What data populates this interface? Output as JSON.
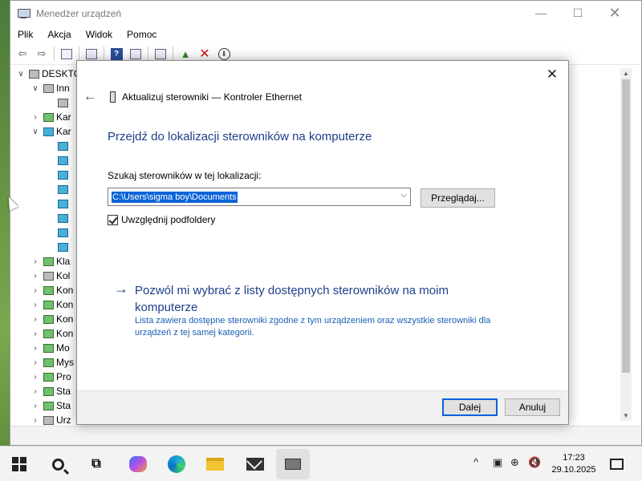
{
  "window": {
    "title": "Menedżer urządzeń",
    "min_glyph": "—",
    "max_glyph": "☐",
    "close_glyph": "✕"
  },
  "menu": [
    "Plik",
    "Akcja",
    "Widok",
    "Pomoc"
  ],
  "tree": [
    {
      "label": "DESKTO",
      "chevron": "∨",
      "indent": 0,
      "icon": "computer-icon"
    },
    {
      "label": "Inn",
      "chevron": "∨",
      "indent": 1,
      "icon": "device-icon"
    },
    {
      "label": "",
      "chevron": "",
      "indent": 2,
      "icon": "warning-device-icon"
    },
    {
      "label": "Kar",
      "chevron": "›",
      "indent": 1,
      "icon": "adapter-icon"
    },
    {
      "label": "Kar",
      "chevron": "∨",
      "indent": 1,
      "icon": "network-icon"
    },
    {
      "label": "",
      "chevron": "",
      "indent": 2,
      "icon": "network-adapter-icon"
    },
    {
      "label": "",
      "chevron": "",
      "indent": 2,
      "icon": "network-adapter-icon"
    },
    {
      "label": "",
      "chevron": "",
      "indent": 2,
      "icon": "network-adapter-icon"
    },
    {
      "label": "",
      "chevron": "",
      "indent": 2,
      "icon": "network-adapter-icon"
    },
    {
      "label": "",
      "chevron": "",
      "indent": 2,
      "icon": "network-adapter-icon"
    },
    {
      "label": "",
      "chevron": "",
      "indent": 2,
      "icon": "network-adapter-icon"
    },
    {
      "label": "",
      "chevron": "",
      "indent": 2,
      "icon": "network-adapter-icon"
    },
    {
      "label": "",
      "chevron": "",
      "indent": 2,
      "icon": "network-adapter-icon"
    },
    {
      "label": "Kla",
      "chevron": "›",
      "indent": 1,
      "icon": "keyboard-icon"
    },
    {
      "label": "Kol",
      "chevron": "›",
      "indent": 1,
      "icon": "device-icon"
    },
    {
      "label": "Kon",
      "chevron": "›",
      "indent": 1,
      "icon": "monitor-icon"
    },
    {
      "label": "Kon",
      "chevron": "›",
      "indent": 1,
      "icon": "controller-icon"
    },
    {
      "label": "Kon",
      "chevron": "›",
      "indent": 1,
      "icon": "controller-icon"
    },
    {
      "label": "Kon",
      "chevron": "›",
      "indent": 1,
      "icon": "controller-icon"
    },
    {
      "label": "Mo",
      "chevron": "›",
      "indent": 1,
      "icon": "monitor-icon"
    },
    {
      "label": "Mys",
      "chevron": "›",
      "indent": 1,
      "icon": "mouse-icon"
    },
    {
      "label": "Pro",
      "chevron": "›",
      "indent": 1,
      "icon": "processor-icon"
    },
    {
      "label": "Sta",
      "chevron": "›",
      "indent": 1,
      "icon": "storage-icon"
    },
    {
      "label": "Sta",
      "chevron": "›",
      "indent": 1,
      "icon": "storage-icon"
    },
    {
      "label": "Urz",
      "chevron": "›",
      "indent": 1,
      "icon": "device-icon"
    }
  ],
  "dialog": {
    "close_glyph": "✕",
    "back_glyph": "←",
    "header": "Aktualizuj sterowniki — Kontroler Ethernet",
    "heading": "Przejdź do lokalizacji sterowników na komputerze",
    "search_label": "Szukaj sterowników w tej lokalizacji:",
    "path_value": "C:\\Users\\sigma boy\\Documents",
    "browse_label": "Przeglądaj...",
    "include_subfolders_label": "Uwzględnij podfoldery",
    "include_subfolders_checked": true,
    "pick_arrow": "→",
    "pick_link": "Pozwól mi wybrać z listy dostępnych sterowników na moim komputerze",
    "pick_desc": "Lista zawiera dostępne sterowniki zgodne z tym urządzeniem oraz wszystkie sterowniki dla urządzeń z tej samej kategorii.",
    "next_label": "Dalej",
    "cancel_label": "Anuluj",
    "link_color": "#1d3f8a"
  },
  "taskbar": {
    "time": "17:23",
    "date": "29.10.2025",
    "tray_chevron": "^"
  }
}
